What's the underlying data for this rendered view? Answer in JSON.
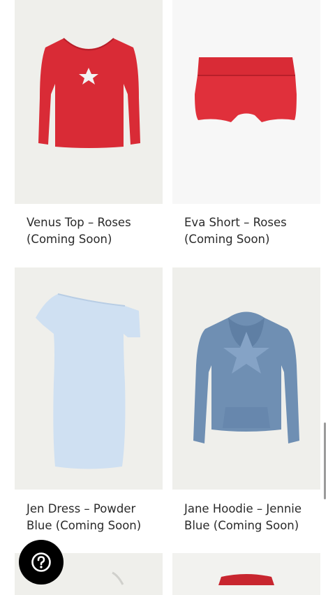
{
  "products": [
    {
      "name": "Venus Top – Roses (Coming Soon)",
      "image_icon": "red-long-sleeve-star-top"
    },
    {
      "name": "Eva Short – Roses (Coming Soon)",
      "image_icon": "red-fold-over-shorts"
    },
    {
      "name": "Jen Dress – Powder Blue (Coming Soon)",
      "image_icon": "powder-blue-off-shoulder-dress"
    },
    {
      "name": "Jane Hoodie – Jennie Blue (Coming Soon)",
      "image_icon": "blue-star-hoodie"
    }
  ],
  "help_button": {
    "icon": "question-mark-icon"
  },
  "colors": {
    "rose_red": "#d92b36",
    "powder_blue": "#cfe0f2",
    "jennie_blue": "#6f8fb3",
    "image_bg": "#efefeb"
  }
}
